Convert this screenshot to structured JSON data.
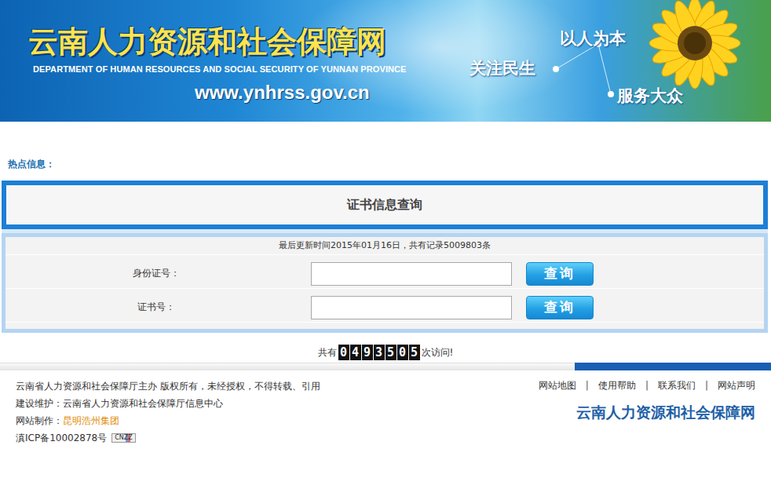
{
  "header": {
    "title": "云南人力资源和社会保障网",
    "subtitle": "DEPARTMENT OF HUMAN RESOURCES AND SOCIAL SECURITY OF YUNNAN PROVINCE",
    "url": "www.ynhrss.gov.cn",
    "slogans": [
      "以人为本",
      "关注民生",
      "服务大众"
    ]
  },
  "hot_info": {
    "label": "热点信息："
  },
  "query_panel": {
    "title": "证书信息查询",
    "update_text": "最后更新时间2015年01月16日，共有记录5009803条",
    "fields": [
      {
        "label": "身份证号：",
        "value": "",
        "button": "查询"
      },
      {
        "label": "证书号：",
        "value": "",
        "button": "查询"
      }
    ]
  },
  "visit_counter": {
    "prefix": "共有",
    "digits": "0493505",
    "suffix": "次访问!"
  },
  "footer": {
    "lines": [
      "云南省人力资源和社会保障厅主办 版权所有，未经授权，不得转载、引用",
      "建设维护：云南省人力资源和社会保障厅信息中心"
    ],
    "maker": {
      "label": "网站制作：",
      "link": "昆明浩州集团"
    },
    "icp": "滇ICP备10002878号",
    "badge": "CNZZ",
    "links": [
      "网站地图",
      "使用帮助",
      "联系我们",
      "网站声明"
    ],
    "separator": "|",
    "logo": "云南人力资源和社会保障网"
  }
}
